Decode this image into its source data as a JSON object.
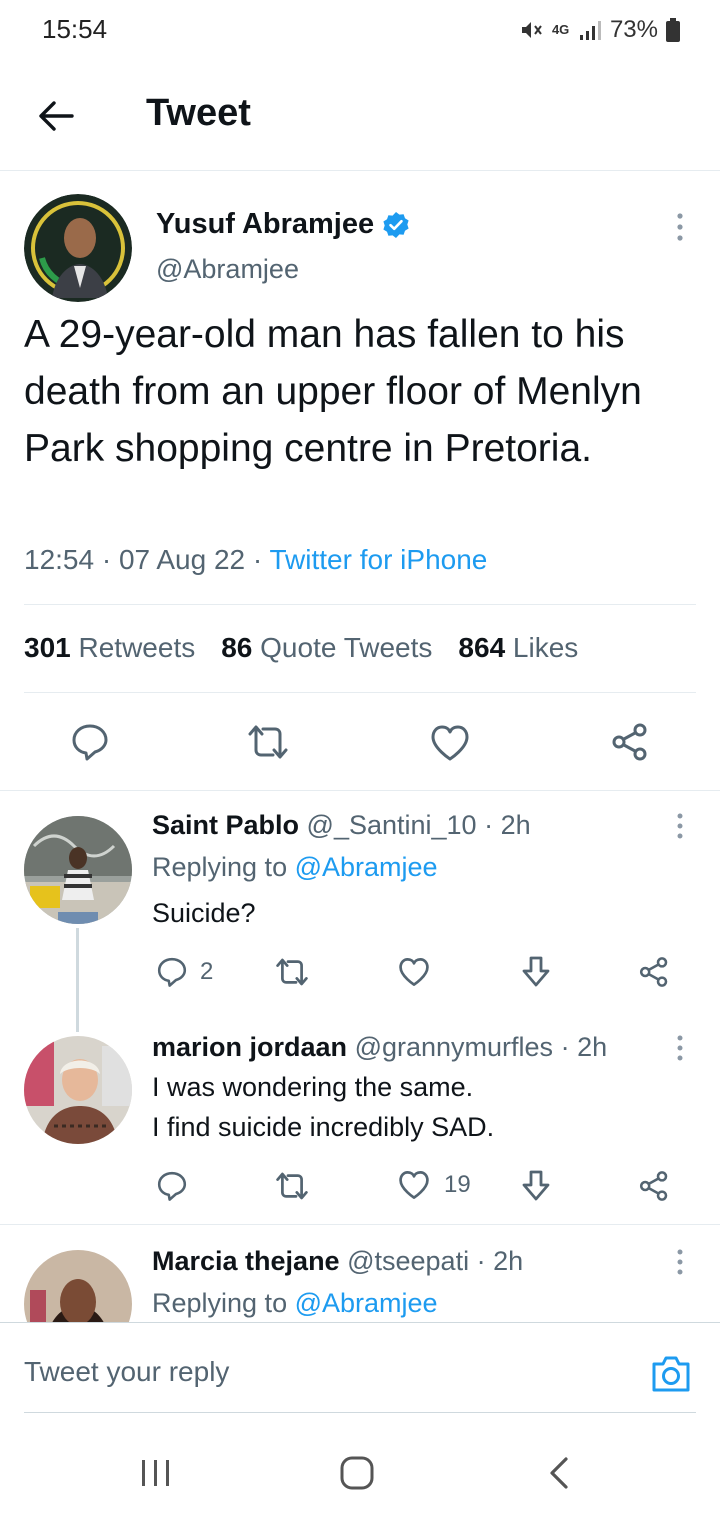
{
  "status_bar": {
    "time": "15:54",
    "network": "4G",
    "battery": "73%"
  },
  "header": {
    "title": "Tweet",
    "back_icon": "arrow-left-icon"
  },
  "tweet": {
    "author_name": "Yusuf Abramjee",
    "author_handle": "@Abramjee",
    "text": "A 29-year-old man has fallen to his death from an upper floor of Menlyn Park shopping centre in Pretoria.",
    "time": "12:54",
    "date": "07 Aug 22",
    "source": "Twitter for iPhone",
    "retweets_count": "301",
    "retweets_label": "Retweets",
    "quotes_count": "86",
    "quotes_label": "Quote Tweets",
    "likes_count": "864",
    "likes_label": "Likes"
  },
  "replies": [
    {
      "name": "Saint Pablo",
      "handle": "@_Santini_10",
      "time": "2h",
      "replying_prefix": "Replying to",
      "replying_to": "@Abramjee",
      "text": "Suicide?",
      "reply_count": "2",
      "like_count": ""
    },
    {
      "name": "marion jordaan",
      "handle": "@grannymurfles",
      "time": "2h",
      "text_line1": "I was wondering the same.",
      "text_line2": "I find suicide incredibly SAD.",
      "reply_count": "",
      "like_count": "19"
    },
    {
      "name": "Marcia thejane",
      "handle": "@tseepati",
      "time": "2h",
      "replying_prefix": "Replying to",
      "replying_to": "@Abramjee"
    }
  ],
  "composer": {
    "placeholder": "Tweet your reply"
  },
  "colors": {
    "accent": "#1d9bf0",
    "text": "#0f1419",
    "secondary": "#536471",
    "divider": "#e6ecf0"
  }
}
